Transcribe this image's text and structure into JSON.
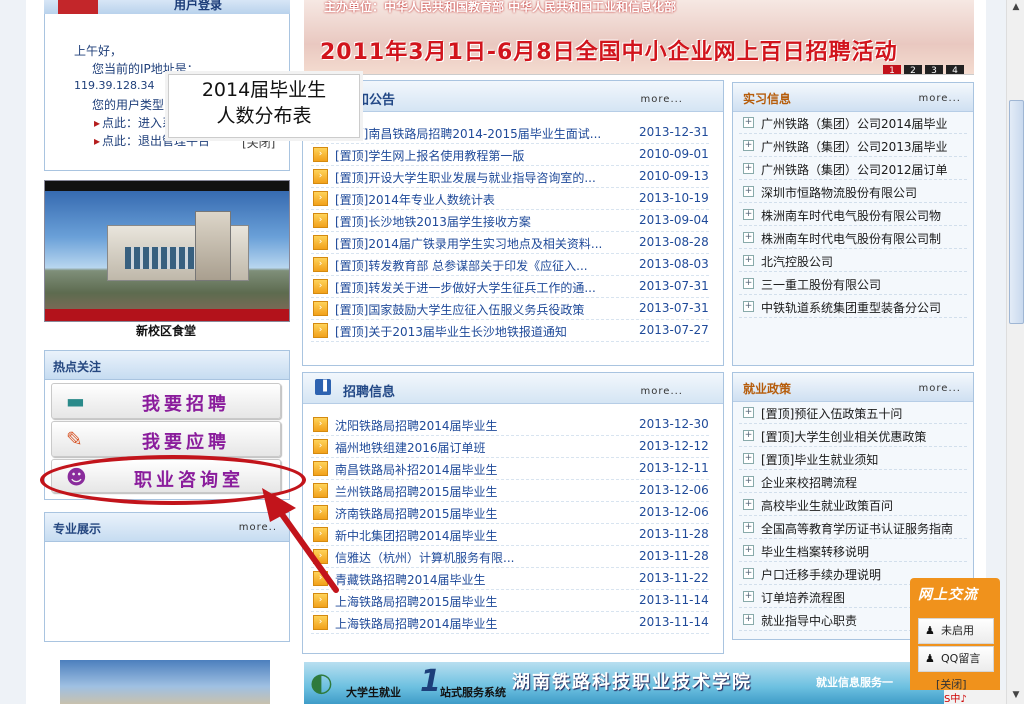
{
  "login": {
    "title": "用户登录",
    "greeting": "上午好，",
    "ip_label": "您当前的IP地址是：",
    "ip": "119.39.128.34",
    "usertype_label": "您的用户类型",
    "link1": "点此：进入系",
    "link2": "点此：退出管理平台",
    "close": "[关闭]"
  },
  "photo": {
    "caption": "新校区食堂"
  },
  "hot": {
    "title": "热点关注",
    "buttons": [
      {
        "label": "我要招聘",
        "icon": "blackboard-icon"
      },
      {
        "label": "我要应聘",
        "icon": "pencil-icon"
      },
      {
        "label": "职业咨询室",
        "icon": "person-icon"
      }
    ]
  },
  "spec": {
    "title": "专业展示",
    "more": "more.."
  },
  "banner": {
    "org": "主办单位：中华人民共和国教育部  中华人民共和国工业和信息化部",
    "main": "2011年3月1日-6月8日全国中小企业网上百日招聘活动",
    "pages": [
      "1",
      "2",
      "3",
      "4"
    ]
  },
  "notice": {
    "title": "通知公告",
    "more": "more...",
    "items": [
      {
        "title": "[置顶]南昌铁路局招聘2014-2015届毕业生面试...",
        "date": "2013-12-31"
      },
      {
        "title": "[置顶]学生网上报名使用教程第一版",
        "date": "2010-09-01"
      },
      {
        "title": "[置顶]开设大学生职业发展与就业指导咨询室的...",
        "date": "2010-09-13"
      },
      {
        "title": "[置顶]2014年专业人数统计表",
        "date": "2013-10-19"
      },
      {
        "title": "[置顶]长沙地铁2013届学生接收方案",
        "date": "2013-09-04"
      },
      {
        "title": "[置顶]2014届广铁录用学生实习地点及相关资料...",
        "date": "2013-08-28"
      },
      {
        "title": "[置顶]转发教育部 总参谋部关于印发《应征入...",
        "date": "2013-08-03"
      },
      {
        "title": "[置顶]转发关于进一步做好大学生征兵工作的通...",
        "date": "2013-07-31"
      },
      {
        "title": "[置顶]国家鼓励大学生应征入伍服义务兵役政策",
        "date": "2013-07-31"
      },
      {
        "title": "[置顶]关于2013届毕业生长沙地铁报道通知",
        "date": "2013-07-27"
      }
    ]
  },
  "recruit": {
    "title": "招聘信息",
    "more": "more...",
    "items": [
      {
        "title": "沈阳铁路局招聘2014届毕业生",
        "date": "2013-12-30"
      },
      {
        "title": "福州地铁组建2016届订单班",
        "date": "2013-12-12"
      },
      {
        "title": "南昌铁路局补招2014届毕业生",
        "date": "2013-12-11"
      },
      {
        "title": "兰州铁路局招聘2015届毕业生",
        "date": "2013-12-06"
      },
      {
        "title": "济南铁路局招聘2015届毕业生",
        "date": "2013-12-06"
      },
      {
        "title": "新中北集团招聘2014届毕业生",
        "date": "2013-11-28"
      },
      {
        "title": "信雅达（杭州）计算机服务有限...",
        "date": "2013-11-28"
      },
      {
        "title": "青藏铁路招聘2014届毕业生",
        "date": "2013-11-22"
      },
      {
        "title": "上海铁路局招聘2015届毕业生",
        "date": "2013-11-14"
      },
      {
        "title": "上海铁路局招聘2014届毕业生",
        "date": "2013-11-14"
      }
    ]
  },
  "intern": {
    "title": "实习信息",
    "more": "more...",
    "items": [
      "广州铁路（集团）公司2014届毕业",
      "广州铁路（集团）公司2013届毕业",
      "广州铁路（集团）公司2012届订单",
      "深圳市恒路物流股份有限公司",
      "株洲南车时代电气股份有限公司物",
      "株洲南车时代电气股份有限公司制",
      "北汽控股公司",
      "三一重工股份有限公司",
      "中铁轨道系统集团重型装备分公司"
    ]
  },
  "policy": {
    "title": "就业政策",
    "more": "more...",
    "items": [
      "[置顶]预征入伍政策五十问",
      "[置顶]大学生创业相关优惠政策",
      "[置顶]毕业生就业须知",
      "企业来校招聘流程",
      "高校毕业生就业政策百问",
      "全国高等教育学历证书认证服务指南",
      "毕业生档案转移说明",
      "户口迁移手续办理说明",
      "订单培养流程图",
      "就业指导中心职责"
    ]
  },
  "bottom_banner": {
    "left": "大学生就业",
    "one": "1",
    "mid_suffix": "站式服务系统",
    "school": "湖南铁路科技职业技术学院",
    "right": "就业信息服务一"
  },
  "chat": {
    "title": "网上交流",
    "item1": "未启用",
    "item2": "QQ留言",
    "close": "[关闭]"
  },
  "annotation": {
    "line1": "2014届毕业生",
    "line2": "人数分布表"
  },
  "tray": {
    "text": "S中♪"
  },
  "colors": {
    "accent_red": "#c2141b",
    "link_blue": "#1f4a99",
    "panel_border": "#a9c4e0"
  }
}
